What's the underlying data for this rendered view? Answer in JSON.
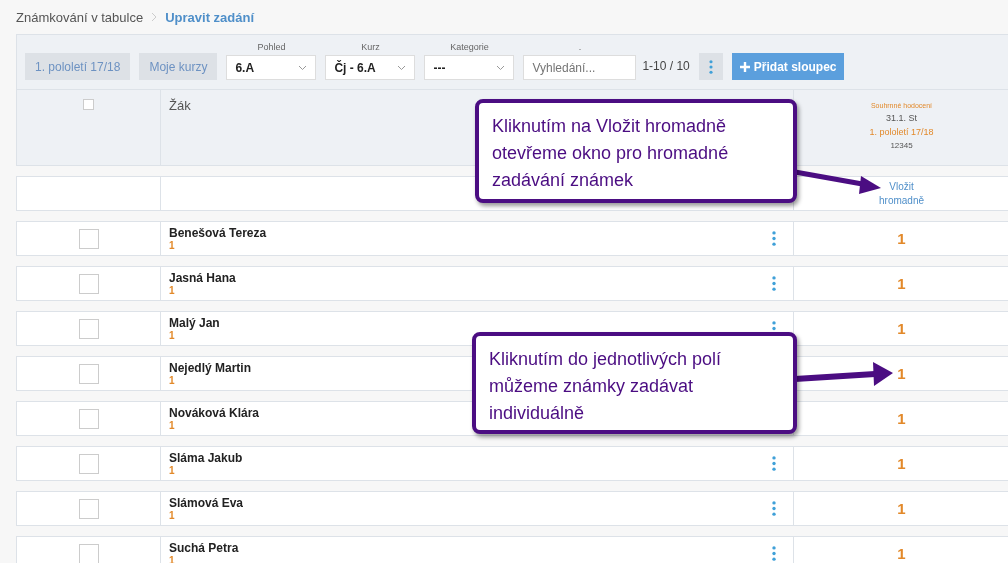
{
  "breadcrumb": [
    {
      "label": "Známkování v tabulce",
      "current": false
    },
    {
      "label": "Upravit zadání",
      "current": true
    }
  ],
  "toolbar": {
    "buttons": [
      "1. pololetí 17/18",
      "Moje kurzy"
    ],
    "filters": [
      {
        "label": "Pohled",
        "value": "6.A"
      },
      {
        "label": "Kurz",
        "value": "Čj - 6.A"
      },
      {
        "label": "Kategorie",
        "value": "---"
      }
    ],
    "search": {
      "label": ".",
      "placeholder": "Vyhledání..."
    },
    "pager": "1-10 / 10",
    "add_button": "Přidat sloupec"
  },
  "table": {
    "select_all": {
      "checked": false
    },
    "name_header": "Žák",
    "assignment": {
      "category": "Souhrnné hodocení",
      "date": "31.1. St",
      "period": "1. pololetí 17/18",
      "code": "12345"
    },
    "bulk_link": "Vložit hromadně",
    "rows": [
      {
        "name": "Benešová Tereza",
        "average": "1",
        "grade": "1",
        "checked": false
      },
      {
        "name": "Jasná Hana",
        "average": "1",
        "grade": "1",
        "checked": false
      },
      {
        "name": "Malý Jan",
        "average": "1",
        "grade": "1",
        "checked": false
      },
      {
        "name": "Nejedlý Martin",
        "average": "1",
        "grade": "1",
        "checked": false
      },
      {
        "name": "Nováková Klára",
        "average": "1",
        "grade": "1",
        "checked": false
      },
      {
        "name": "Sláma Jakub",
        "average": "1",
        "grade": "1",
        "checked": false
      },
      {
        "name": "Slámová Eva",
        "average": "1",
        "grade": "1",
        "checked": false
      },
      {
        "name": "Suchá Petra",
        "average": "1",
        "grade": "1",
        "checked": false
      }
    ]
  },
  "callouts": [
    {
      "text": "Kliknutím na Vložit hromadně otevřeme okno pro hromadné zadávání známek"
    },
    {
      "text": "Kliknutím do jednotlivých polí můžeme známky zadávat individuálně"
    }
  ]
}
